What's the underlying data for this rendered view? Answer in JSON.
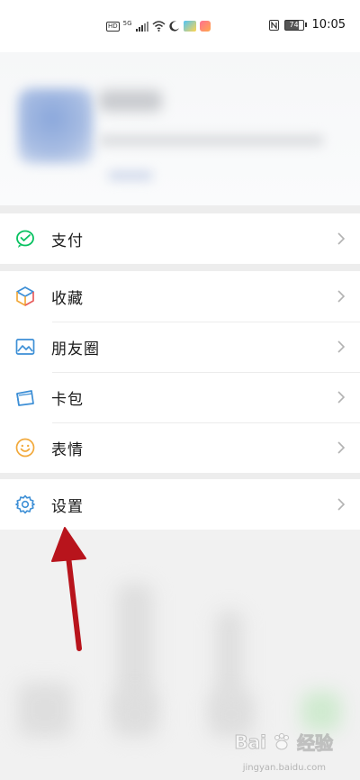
{
  "status_bar": {
    "hd": "HD",
    "network": "5G",
    "battery_level": "74",
    "time": "10:05"
  },
  "menu": {
    "pay_group": [
      {
        "label": "支付",
        "icon": "wechat-pay-icon"
      }
    ],
    "main_group": [
      {
        "label": "收藏",
        "icon": "favorites-cube-icon"
      },
      {
        "label": "朋友圈",
        "icon": "moments-image-icon"
      },
      {
        "label": "卡包",
        "icon": "card-wallet-icon"
      },
      {
        "label": "表情",
        "icon": "emoji-smile-icon"
      }
    ],
    "settings_group": [
      {
        "label": "设置",
        "icon": "settings-gear-icon"
      }
    ]
  },
  "colors": {
    "pay_green": "#07c160",
    "icon_blue": "#3d8fd6",
    "emoji_orange": "#f2a93b",
    "arrow_red": "#b8141c"
  },
  "watermark": {
    "logo": "Bai",
    "text": "经验",
    "url": "jingyan.baidu.com"
  }
}
